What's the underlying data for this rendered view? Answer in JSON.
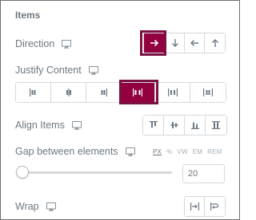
{
  "section": {
    "title": "Items"
  },
  "direction": {
    "label": "Direction",
    "monitor_icon": "desktop-icon",
    "options": [
      "arrow-right-icon",
      "arrow-down-icon",
      "arrow-left-icon",
      "arrow-up-icon"
    ],
    "selected": "arrow-right-icon"
  },
  "justify": {
    "label": "Justify Content",
    "monitor_icon": "desktop-icon",
    "options": [
      "justify-start-icon",
      "justify-center-icon",
      "justify-end-icon",
      "justify-space-between-icon",
      "justify-space-around-icon",
      "justify-space-evenly-icon"
    ],
    "selected": "justify-space-between-icon"
  },
  "align": {
    "label": "Align Items",
    "monitor_icon": "desktop-icon",
    "options": [
      "align-start-icon",
      "align-center-icon",
      "align-end-icon",
      "align-stretch-icon"
    ]
  },
  "gap": {
    "label": "Gap between elements",
    "monitor_icon": "desktop-icon",
    "units": [
      "PX",
      "%",
      "VW",
      "EM",
      "REM"
    ],
    "selected_unit": "PX",
    "placeholder": "20"
  },
  "wrap": {
    "label": "Wrap",
    "monitor_icon": "desktop-icon",
    "options": [
      "no-wrap-icon",
      "wrap-icon"
    ]
  },
  "colors": {
    "accent": "#93003f",
    "highlight": "#7b1143",
    "text": "#6d7882",
    "border": "#d5d8dc"
  }
}
